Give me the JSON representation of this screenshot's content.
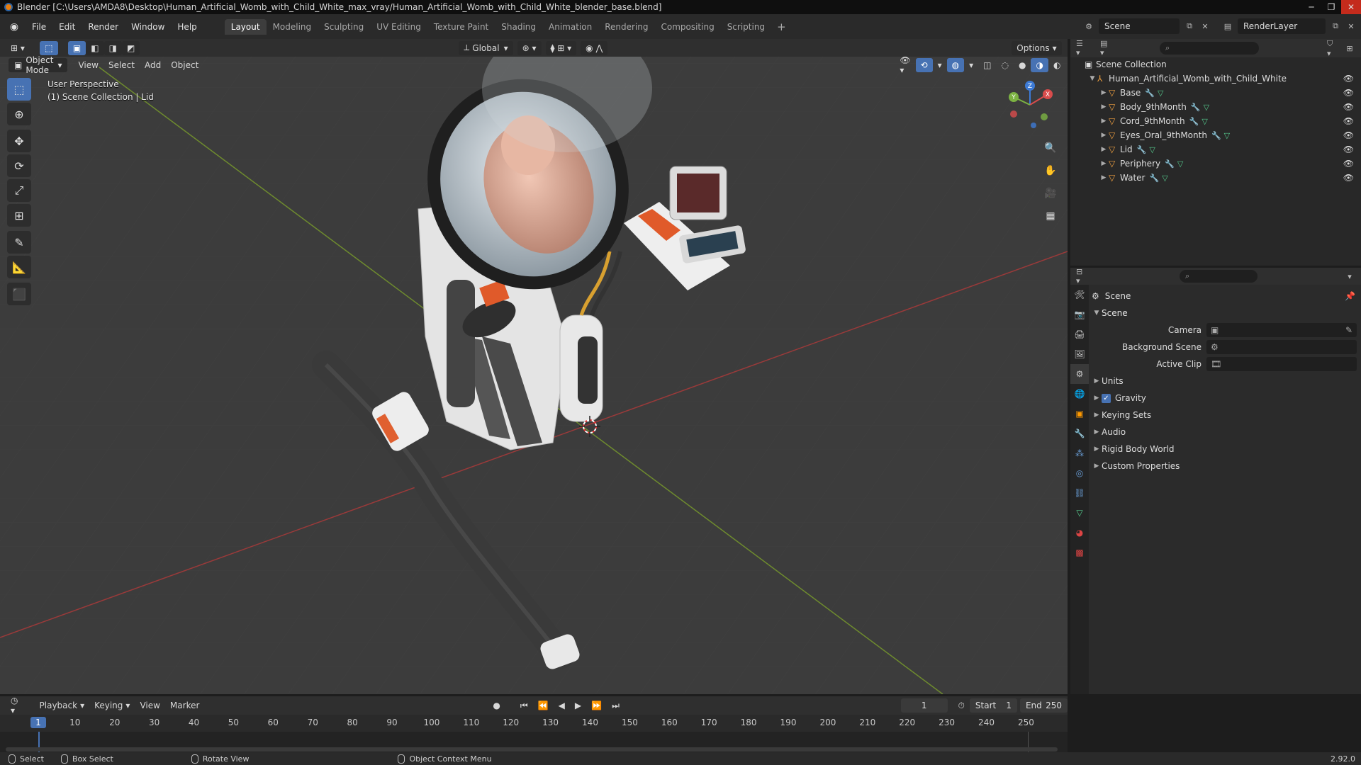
{
  "window": {
    "title": "Blender [C:\\Users\\AMDA8\\Desktop\\Human_Artificial_Womb_with_Child_White_max_vray/Human_Artificial_Womb_with_Child_White_blender_base.blend]",
    "controls": [
      "─",
      "❐",
      "✕"
    ]
  },
  "menu": {
    "items": [
      "File",
      "Edit",
      "Render",
      "Window",
      "Help"
    ]
  },
  "workspaces": {
    "tabs": [
      "Layout",
      "Modeling",
      "Sculpting",
      "UV Editing",
      "Texture Paint",
      "Shading",
      "Animation",
      "Rendering",
      "Compositing",
      "Scripting"
    ],
    "active": "Layout",
    "add": "+"
  },
  "scene": {
    "name": "Scene"
  },
  "render_layer": {
    "name": "RenderLayer"
  },
  "viewport_header": {
    "orientation": "Global",
    "options": "Options",
    "mode": "Object Mode",
    "menus": [
      "View",
      "Select",
      "Add",
      "Object"
    ]
  },
  "viewport": {
    "perspective": "User Perspective",
    "collection": "(1) Scene Collection | Lid",
    "gizmo": {
      "x": "X",
      "y": "Y",
      "z": "Z"
    }
  },
  "outliner": {
    "root": "Scene Collection",
    "collection": "Human_Artificial_Womb_with_Child_White",
    "objects": [
      "Base",
      "Body_9thMonth",
      "Cord_9thMonth",
      "Eyes_Oral_9thMonth",
      "Lid",
      "Periphery",
      "Water"
    ]
  },
  "properties": {
    "context": "Scene",
    "panel": "Scene",
    "fields": [
      {
        "label": "Camera",
        "value": ""
      },
      {
        "label": "Background Scene",
        "value": ""
      },
      {
        "label": "Active Clip",
        "value": ""
      }
    ],
    "subpanels": [
      "Units",
      "Gravity",
      "Keying Sets",
      "Audio",
      "Rigid Body World",
      "Custom Properties"
    ],
    "gravity_checked": true
  },
  "timeline": {
    "menus": [
      "Playback",
      "Keying",
      "View",
      "Marker"
    ],
    "current_frame": "1",
    "start_label": "Start",
    "start": "1",
    "end_label": "End",
    "end": "250",
    "ticks": [
      "1",
      "10",
      "20",
      "30",
      "40",
      "50",
      "60",
      "70",
      "80",
      "90",
      "100",
      "110",
      "120",
      "130",
      "140",
      "150",
      "160",
      "170",
      "180",
      "190",
      "200",
      "210",
      "220",
      "230",
      "240",
      "250"
    ]
  },
  "statusbar": {
    "select": "Select",
    "box_select": "Box Select",
    "rotate_view": "Rotate View",
    "context_menu": "Object Context Menu",
    "version": "2.92.0"
  }
}
